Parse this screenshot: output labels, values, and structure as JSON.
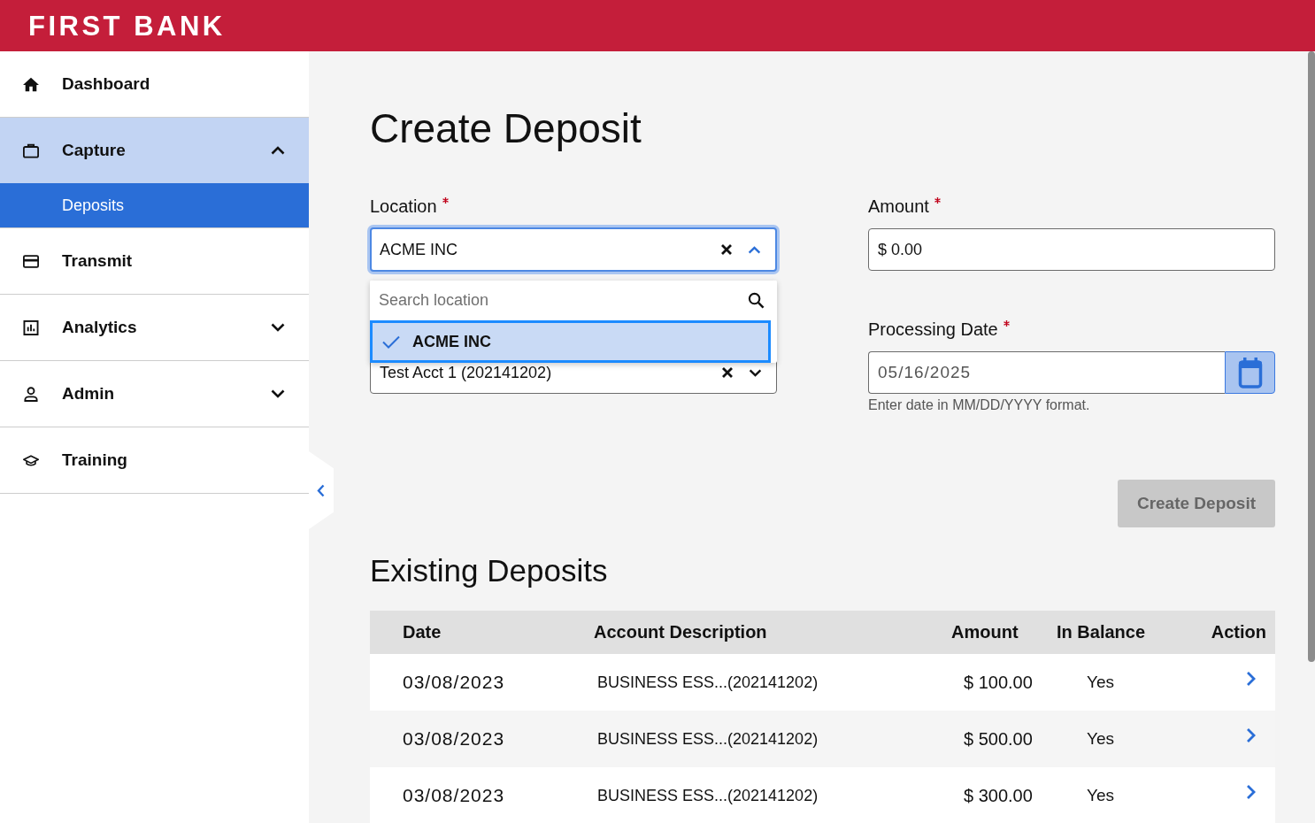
{
  "header": {
    "logo": "FIRST BANK"
  },
  "sidebar": {
    "items": [
      {
        "label": "Dashboard",
        "kind": "link",
        "selected": false
      },
      {
        "label": "Capture",
        "kind": "group",
        "selected": true,
        "expanded": true,
        "children": [
          {
            "label": "Deposits",
            "selected": true
          }
        ]
      },
      {
        "label": "Transmit",
        "kind": "link",
        "selected": false
      },
      {
        "label": "Analytics",
        "kind": "group",
        "selected": false,
        "expanded": false
      },
      {
        "label": "Admin",
        "kind": "group",
        "selected": false,
        "expanded": false
      },
      {
        "label": "Training",
        "kind": "link",
        "selected": false
      }
    ]
  },
  "page_title": "Create Deposit",
  "form": {
    "location": {
      "label": "Location",
      "required": true,
      "value": "ACME INC",
      "expanded": true,
      "search": {
        "placeholder": "Search location"
      },
      "options": [
        {
          "label": "ACME INC",
          "selected": true
        }
      ]
    },
    "account": {
      "value": "Test Acct 1 (202141202)",
      "expanded": false
    },
    "amount": {
      "label": "Amount",
      "required": true,
      "value": "$ 0.00"
    },
    "processing_date": {
      "label": "Processing Date",
      "required": true,
      "value": "05/16/2025",
      "hint": "Enter date in MM/DD/YYYY format."
    },
    "submit": {
      "label": "Create Deposit",
      "disabled": true
    }
  },
  "existing_deposits": {
    "title": "Existing Deposits",
    "table": {
      "columns": [
        "Date",
        "Account Description",
        "Amount",
        "In Balance",
        "Action"
      ],
      "rows": [
        {
          "date": "03/08/2023",
          "account_description": "BUSINESS ESS...(202141202)",
          "amount": "$ 100.00",
          "in_balance": "Yes"
        },
        {
          "date": "03/08/2023",
          "account_description": "BUSINESS ESS...(202141202)",
          "amount": "$ 500.00",
          "in_balance": "Yes"
        },
        {
          "date": "03/08/2023",
          "account_description": "BUSINESS ESS...(202141202)",
          "amount": "$ 300.00",
          "in_balance": "Yes"
        }
      ]
    }
  }
}
